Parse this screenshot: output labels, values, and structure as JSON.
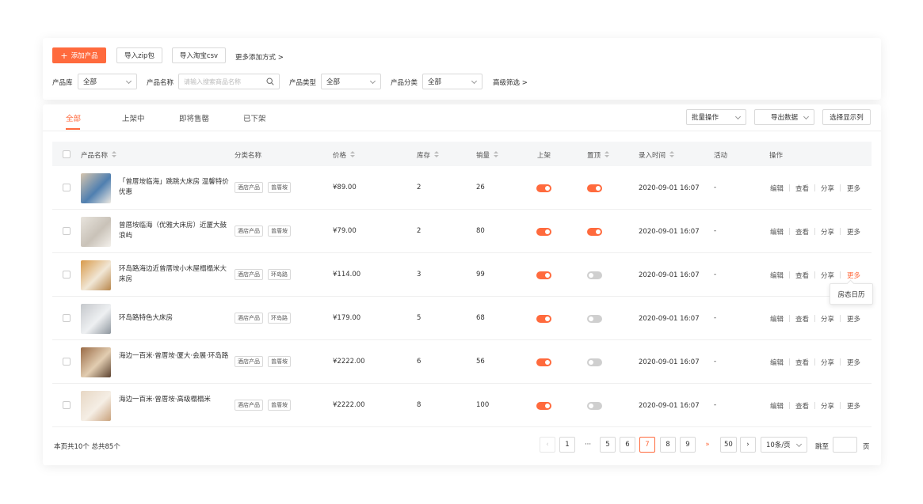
{
  "toolbar": {
    "add_product": "添加产品",
    "import_zip": "导入zip包",
    "import_taobao": "导入淘宝csv",
    "more_add": "更多添加方式 >"
  },
  "filters": {
    "library_label": "产品库",
    "library_value": "全部",
    "name_label": "产品名称",
    "name_placeholder": "请输入搜索商品名称",
    "type_label": "产品类型",
    "type_value": "全部",
    "category_label": "产品分类",
    "category_value": "全部",
    "advanced": "高级筛选 >"
  },
  "tabs": [
    "全部",
    "上架中",
    "即将售罄",
    "已下架"
  ],
  "actions": {
    "batch": "批量操作",
    "export": "导出数据",
    "columns": "选择显示列"
  },
  "columns": [
    "产品名称",
    "分类名称",
    "价格",
    "库存",
    "销量",
    "上架",
    "置顶",
    "录入时间",
    "活动",
    "操作"
  ],
  "rows": [
    {
      "name": "「曾厝垵临海」跳跳大床房 温馨特价优惠",
      "tags": [
        "酒店产品",
        "曾厝垵"
      ],
      "price": "¥89.00",
      "stock": "2",
      "sales": "26",
      "listed": true,
      "pinned": true,
      "time": "2020-09-01 16:07",
      "activity": "-"
    },
    {
      "name": "曾厝垵临海（优雅大床房）近厦大鼓浪屿",
      "tags": [
        "酒店产品",
        "曾厝垵"
      ],
      "price": "¥79.00",
      "stock": "2",
      "sales": "80",
      "listed": true,
      "pinned": true,
      "time": "2020-09-01 16:07",
      "activity": "-"
    },
    {
      "name": "环岛路海边近曾厝垵小木屋榻榻米大床房",
      "tags": [
        "酒店产品",
        "环岛路"
      ],
      "price": "¥114.00",
      "stock": "3",
      "sales": "99",
      "listed": true,
      "pinned": false,
      "time": "2020-09-01 16:07",
      "activity": "-"
    },
    {
      "name": "环岛路特色大床房",
      "tags": [
        "酒店产品",
        "环岛路"
      ],
      "price": "¥179.00",
      "stock": "5",
      "sales": "68",
      "listed": true,
      "pinned": false,
      "time": "2020-09-01 16:07",
      "activity": "-"
    },
    {
      "name": "海边一百米·曾厝垵·厦大·会展·环岛路",
      "tags": [
        "酒店产品",
        "曾厝垵"
      ],
      "price": "¥2222.00",
      "stock": "6",
      "sales": "56",
      "listed": true,
      "pinned": false,
      "time": "2020-09-01 16:07",
      "activity": "-"
    },
    {
      "name": "海边一百米·曾厝垵·高级榻榻米",
      "tags": [
        "酒店产品",
        "曾厝垵"
      ],
      "price": "¥2222.00",
      "stock": "8",
      "sales": "100",
      "listed": true,
      "pinned": false,
      "time": "2020-09-01 16:07",
      "activity": "-"
    }
  ],
  "row_actions": [
    "编辑",
    "查看",
    "分享",
    "更多"
  ],
  "tooltip": "房态日历",
  "footer": {
    "summary": "本页共10个  总共85个",
    "pages": [
      "1",
      "···",
      "5",
      "6",
      "7",
      "8",
      "9",
      "»",
      "50"
    ],
    "current_page": "7",
    "page_size": "10条/页",
    "goto_label": "跳至",
    "page_unit": "页"
  },
  "colors": {
    "accent": "#ff6a3d",
    "toggle_off": "#cfcfcf"
  }
}
